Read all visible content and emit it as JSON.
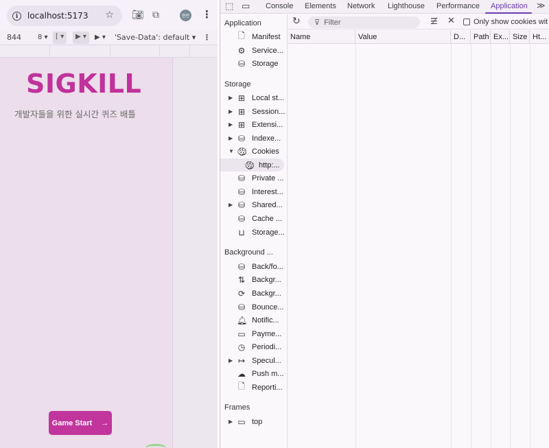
{
  "browser": {
    "url": "localhost:5173",
    "avatar_text": "현빈",
    "device_toolbar": {
      "width": "844",
      "dd1": "8",
      "dd2": "[",
      "dd3": "▶",
      "dd4": "▶",
      "save_data": "'Save-Data': default"
    }
  },
  "page": {
    "logo": "SIGKILL",
    "tagline": "개발자들을 위한 실시간 퀴즈 배틀",
    "game_start": "Game Start",
    "game_start_arrow": "→"
  },
  "devtools": {
    "tabs": [
      "Console",
      "Elements",
      "Network",
      "Lighthouse",
      "Performance",
      "Application"
    ],
    "active_tab": "Application",
    "sidebar": {
      "application_title": "Application",
      "application_items": [
        "Manifest",
        "Service...",
        "Storage"
      ],
      "storage_title": "Storage",
      "storage_items": [
        "Local st...",
        "Session...",
        "Extensi...",
        "Indexe...",
        "Cookies",
        "http:...",
        "Private ...",
        "Interest...",
        "Shared...",
        "Cache ...",
        "Storage..."
      ],
      "background_title": "Background ...",
      "background_items": [
        "Back/fo...",
        "Backgr...",
        "Backgr...",
        "Bounce...",
        "Notific...",
        "Payme...",
        "Periodi...",
        "Specul...",
        "Push m...",
        "Reporti..."
      ],
      "frames_title": "Frames",
      "frames_items": [
        "top"
      ]
    },
    "toolbar": {
      "filter_placeholder": "Filter",
      "only_cookies_label": "Only show cookies wit"
    },
    "table_headers": [
      "Name",
      "Value",
      "D...",
      "Path",
      "Ex...",
      "Size",
      "Ht..."
    ]
  },
  "colors": {
    "brand": "#c0329c",
    "accent": "#6a3ab0"
  }
}
